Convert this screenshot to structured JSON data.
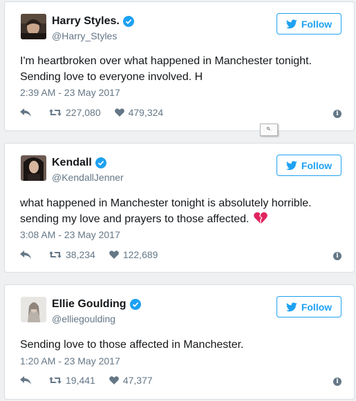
{
  "colors": {
    "accent": "#1da1f2",
    "muted": "#657786",
    "heart_broken": "#e0245e"
  },
  "tweets": [
    {
      "name": "Harry Styles.",
      "handle": "@Harry_Styles",
      "follow_label": "Follow",
      "text": "I'm heartbroken over what happened in Manchester tonight. Sending love to everyone involved. H",
      "timestamp": "2:39 AM - 23 May 2017",
      "retweets": "227,080",
      "likes": "479,324",
      "verified": true
    },
    {
      "name": "Kendall",
      "handle": "@KendallJenner",
      "follow_label": "Follow",
      "text": "what happened in Manchester tonight is absolutely horrible. sending my love and prayers to those affected.",
      "emoji": "broken-heart-icon",
      "timestamp": "3:08 AM - 23 May 2017",
      "retweets": "38,234",
      "likes": "122,689",
      "verified": true
    },
    {
      "name": "Ellie Goulding",
      "handle": "@elliegoulding",
      "follow_label": "Follow",
      "text": "Sending love to those affected in Manchester.",
      "timestamp": "1:20 AM - 23 May 2017",
      "retweets": "19,441",
      "likes": "47,377",
      "verified": true
    }
  ]
}
